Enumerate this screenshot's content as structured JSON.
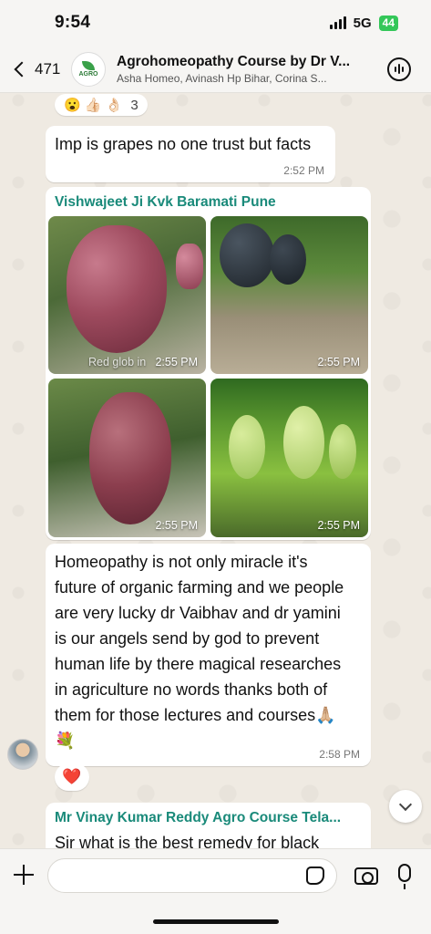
{
  "status_bar": {
    "time": "9:54",
    "network": "5G",
    "battery": "44"
  },
  "header": {
    "back_count": "471",
    "avatar_text": "AGRO",
    "title": "Agrohomeopathy Course by Dr V...",
    "members": "Asha Homeo, Avinash Hp Bihar, Corina S..."
  },
  "top_reactions": {
    "emojis": "😮 👍🏻 👌🏻",
    "count": "3"
  },
  "messages": [
    {
      "text": "Imp is grapes no one trust but facts",
      "time": "2:52 PM"
    },
    {
      "sender": "Vishwajeet Ji Kvk Baramati Pune",
      "photos": [
        {
          "time": "2:55 PM",
          "caption": "Red glob in"
        },
        {
          "time": "2:55 PM"
        },
        {
          "time": "2:55 PM"
        },
        {
          "time": "2:55 PM"
        }
      ]
    },
    {
      "lines": [
        "Homeopathy is not only miracle it's",
        "future of organic farming and we people",
        "are very lucky dr Vaibhav and dr yamini",
        "is our angels send by god to prevent",
        "human life by there magical researches",
        "in agriculture no words thanks both of",
        "them for those lectures and courses🙏🏼",
        "💐"
      ],
      "time": "2:58 PM",
      "reaction": "❤️"
    },
    {
      "sender": "Mr Vinay Kumar Reddy Agro Course Tela...",
      "text": "Sir what is the best remedy for black"
    }
  ],
  "input": {
    "placeholder": ""
  },
  "colors": {
    "sender": "#1a8a7a",
    "bubble": "#ffffff",
    "background": "#efeae2",
    "battery": "#34c759"
  }
}
